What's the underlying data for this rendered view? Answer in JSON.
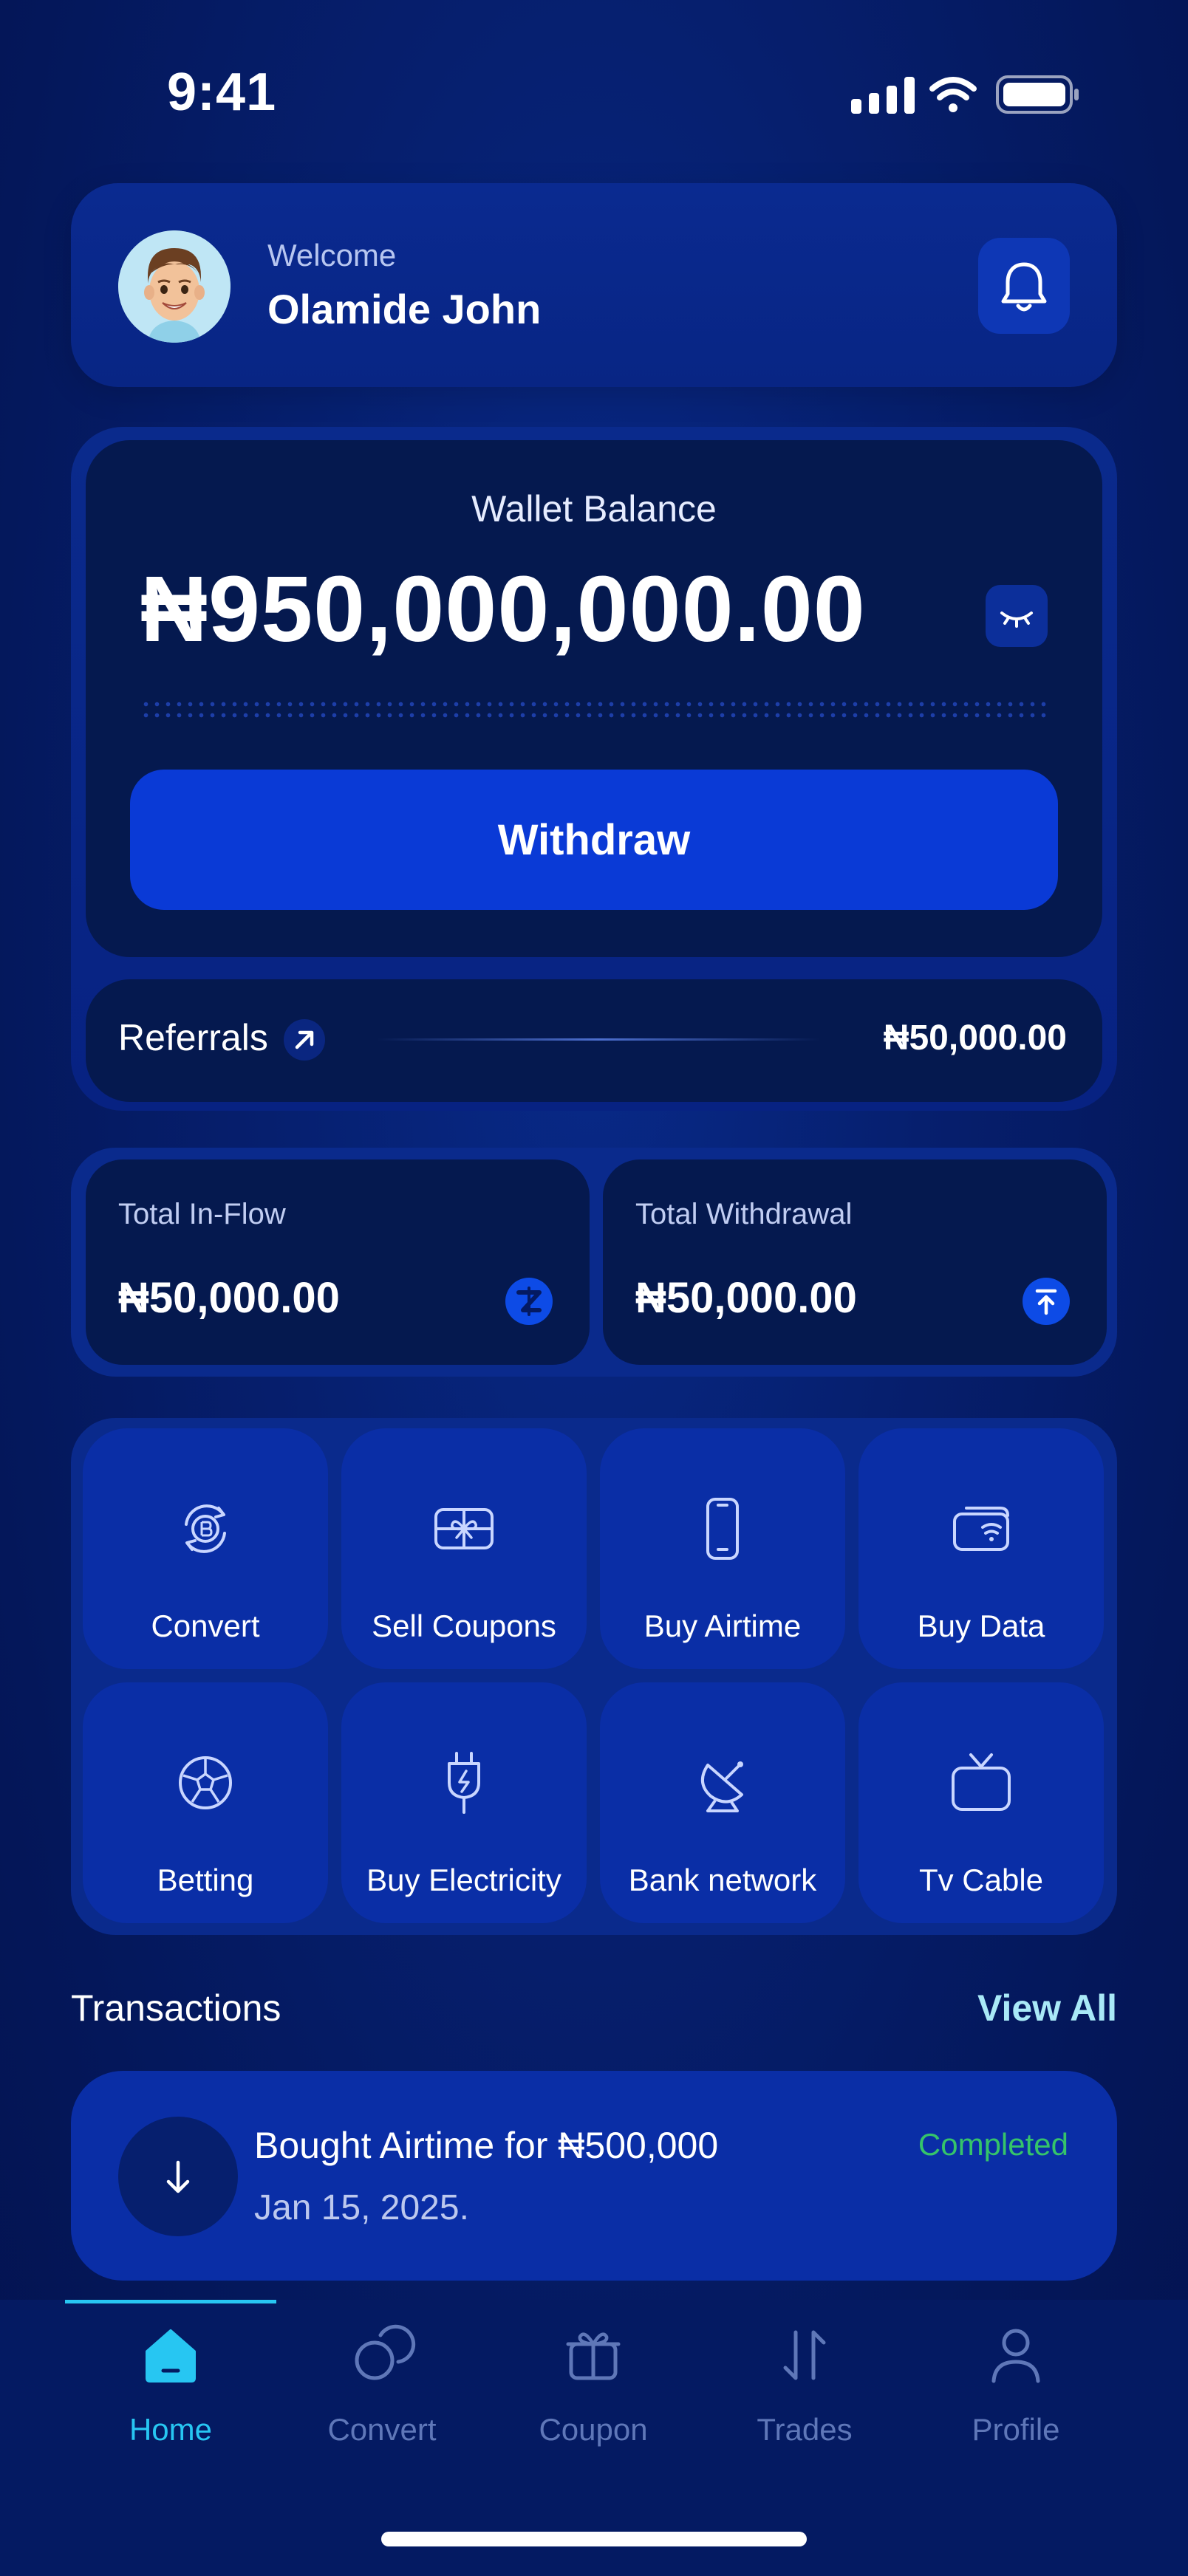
{
  "status_bar": {
    "time": "9:41"
  },
  "header": {
    "welcome": "Welcome",
    "name": "Olamide John"
  },
  "wallet": {
    "label": "Wallet Balance",
    "amount": "₦950,000,000.00",
    "withdraw_label": "Withdraw"
  },
  "referrals": {
    "label": "Referrals",
    "amount": "₦50,000.00"
  },
  "stats": [
    {
      "label": "Total In-Flow",
      "value": "₦50,000.00"
    },
    {
      "label": "Total Withdrawal",
      "value": "₦50,000.00"
    }
  ],
  "services": [
    {
      "label": "Convert",
      "icon": "bitcoin-convert-icon"
    },
    {
      "label": "Sell Coupons",
      "icon": "gift-card-icon"
    },
    {
      "label": "Buy Airtime",
      "icon": "phone-icon"
    },
    {
      "label": "Buy Data",
      "icon": "wifi-card-icon"
    },
    {
      "label": "Betting",
      "icon": "football-icon"
    },
    {
      "label": "Buy Electricity",
      "icon": "plug-icon"
    },
    {
      "label": "Bank network",
      "icon": "satellite-dish-icon"
    },
    {
      "label": "Tv Cable",
      "icon": "tv-icon"
    }
  ],
  "transactions": {
    "title": "Transactions",
    "view_all": "View All",
    "items": [
      {
        "description": "Bought Airtime for ₦500,000",
        "date": "Jan 15, 2025.",
        "status": "Completed"
      }
    ]
  },
  "nav": [
    {
      "label": "Home",
      "icon": "home-icon",
      "active": true
    },
    {
      "label": "Convert",
      "icon": "convert-icon",
      "active": false
    },
    {
      "label": "Coupon",
      "icon": "coupon-icon",
      "active": false
    },
    {
      "label": "Trades",
      "icon": "trades-icon",
      "active": false
    },
    {
      "label": "Profile",
      "icon": "profile-icon",
      "active": false
    }
  ],
  "colors": {
    "background": "#061f6e",
    "card": "#05194f",
    "accent": "#0a3ad6",
    "nav_active": "#27c6f2",
    "success": "#35c46a"
  }
}
